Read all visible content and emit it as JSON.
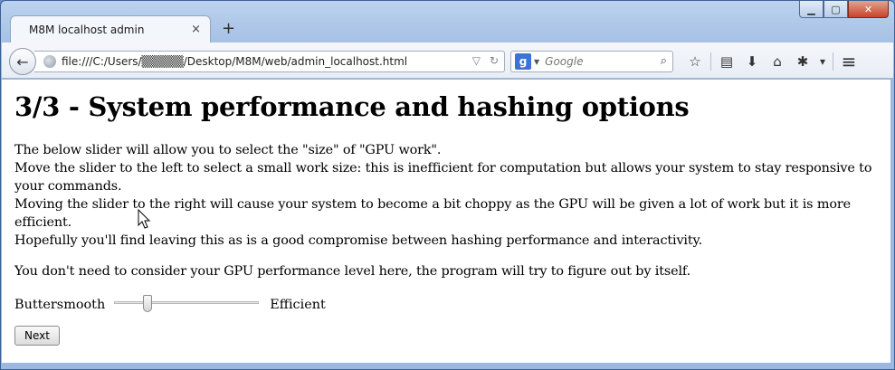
{
  "window": {
    "tab_title": "M8M localhost admin",
    "tab_close": "×",
    "new_tab": "+",
    "caption": {
      "minimize": "▁",
      "maximize": "▢",
      "close": "✕"
    }
  },
  "navbar": {
    "back_glyph": "←",
    "url": "file:///C:/Users/▒▒▒▒▒/Desktop/M8M/web/admin_localhost.html",
    "url_dropdown_glyph": "▽",
    "reload_glyph": "↻",
    "search_engine_letter": "g",
    "search_dropdown_glyph": "▼",
    "search_placeholder": "Google",
    "search_go_glyph": "⌕",
    "icons": [
      "star-icon",
      "reading-list-icon",
      "download-icon",
      "home-icon",
      "addon-icon",
      "dropdown-icon",
      "menu-icon"
    ],
    "icon_glyphs": {
      "star": "☆",
      "reading": "▤",
      "download": "⬇",
      "home": "⌂",
      "addon": "✱",
      "dropdown": "▾",
      "menu": "≡"
    }
  },
  "page": {
    "title": "3/3 - System performance and hashing options",
    "paragraph1": [
      "The below slider will allow you to select the \"size\" of \"GPU work\".",
      "Move the slider to the left to select a small work size: this is inefficient for computation but allows your system to stay responsive to your commands.",
      "Moving the slider to the right will cause your system to become a bit choppy as the GPU will be given a lot of work but it is more efficient.",
      "Hopefully you'll find leaving this as is a good compromise between hashing performance and interactivity."
    ],
    "paragraph2": "You don't need to consider your GPU performance level here, the program will try to figure out by itself.",
    "slider": {
      "left_label": "Buttersmooth",
      "right_label": "Efficient",
      "value_fraction": 0.23
    },
    "next_button": "Next"
  }
}
